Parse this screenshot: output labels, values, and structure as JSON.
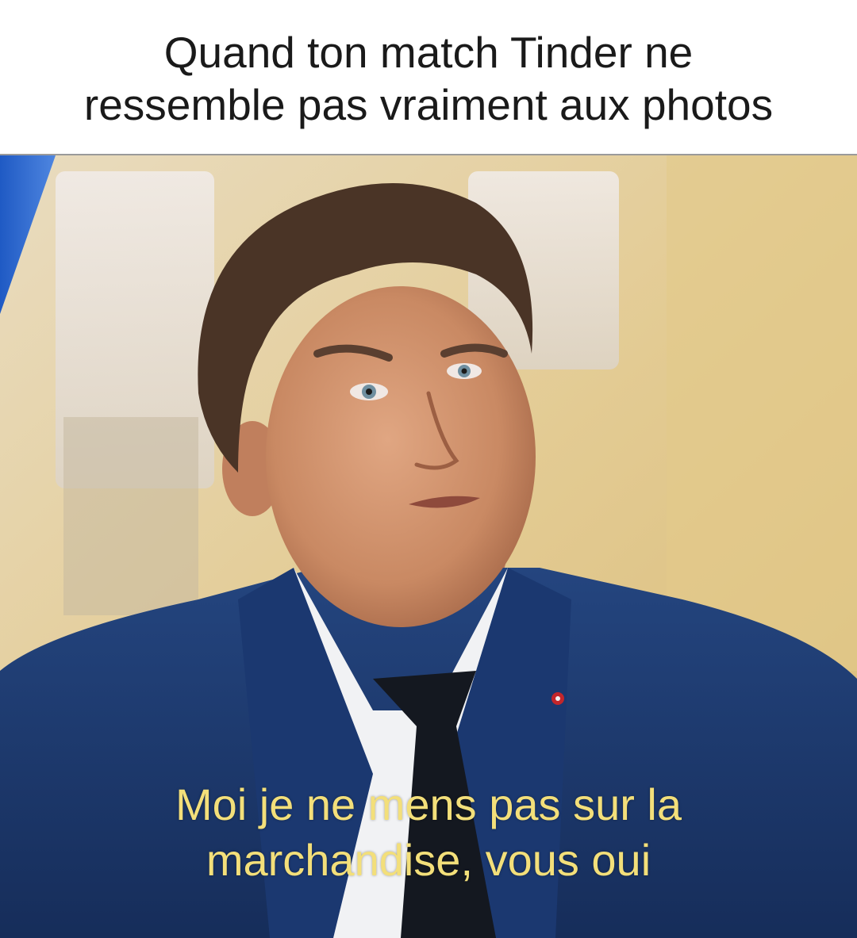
{
  "caption": {
    "line1": "Quand ton match Tinder ne",
    "line2": "ressemble pas vraiment aux photos"
  },
  "subtitle": {
    "line1": "Moi je ne mens pas sur la",
    "line2": "marchandise, vous oui"
  },
  "colors": {
    "caption_text": "#1a1a1a",
    "subtitle_text": "#f3df7a",
    "suit": "#1d3a72",
    "tie": "#14181f",
    "background_wall": "#e7d3a4",
    "accent_blue": "#2a62c8"
  }
}
